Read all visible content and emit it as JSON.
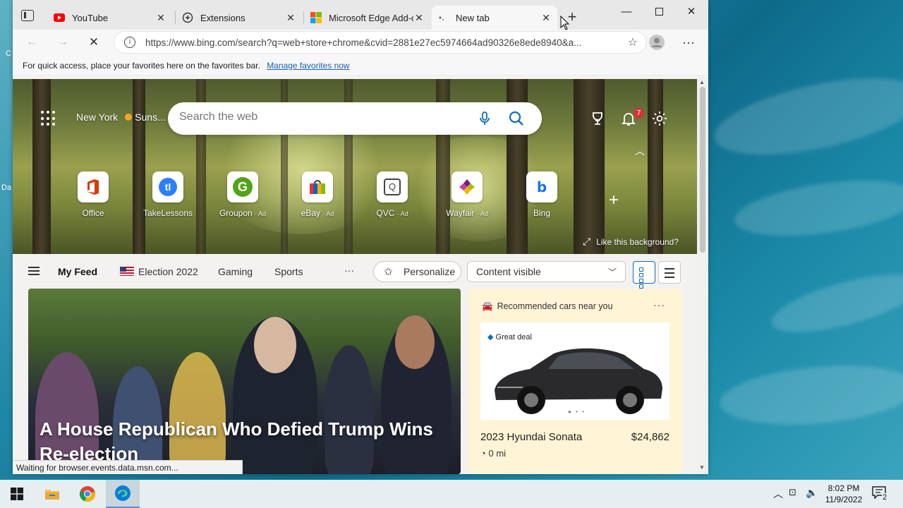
{
  "browser": {
    "tabs": [
      {
        "title": "YouTube",
        "icon": "youtube-icon",
        "active": false
      },
      {
        "title": "Extensions",
        "icon": "puzzle-icon",
        "active": false
      },
      {
        "title": "Microsoft Edge Add-o",
        "icon": "microsoft-icon",
        "active": false
      },
      {
        "title": "New tab",
        "icon": "loading-icon",
        "active": true
      }
    ],
    "address": "https://www.bing.com/search?q=web+store+chrome&cvid=2881e27ec5974664ad90326e8ede8940&a...",
    "favorites_bar": {
      "message": "For quick access, place your favorites here on the favorites bar.",
      "link": "Manage favorites now"
    },
    "status_text": "Waiting for browser.events.data.msn.com..."
  },
  "newtab": {
    "weather_city": "New York",
    "weather_text": "Suns...",
    "search_placeholder": "Search the web",
    "notification_count": "7",
    "quick_links": [
      {
        "label": "Office",
        "ad": ""
      },
      {
        "label": "TakeLessons",
        "ad": ""
      },
      {
        "label": "Groupon",
        "ad": "· Ad"
      },
      {
        "label": "eBay",
        "ad": "· Ad"
      },
      {
        "label": "QVC",
        "ad": "· Ad"
      },
      {
        "label": "Wayfair",
        "ad": "· Ad"
      },
      {
        "label": "Bing",
        "ad": ""
      }
    ],
    "like_background": "Like this background?",
    "feed_nav": {
      "my_feed": "My Feed",
      "items": [
        "Election 2022",
        "Gaming",
        "Sports"
      ],
      "more": "···",
      "personalize": "Personalize",
      "content_visible": "Content visible"
    },
    "headline": "A House Republican Who Defied Trump Wins Re-election",
    "car_card": {
      "header": "Recommended cars near you",
      "badge": "Great deal",
      "model": "2023 Hyundai Sonata",
      "price": "$24,862",
      "miles": "0 mi"
    }
  },
  "taskbar": {
    "time": "8:02 PM",
    "date": "11/9/2022",
    "notification_count": "2"
  },
  "desktop": {
    "icon_labels": [
      "C",
      "Da"
    ]
  },
  "colors": {
    "accent": "#0f6cbd",
    "badge": "#d13438",
    "youtube": "#ff0000"
  }
}
